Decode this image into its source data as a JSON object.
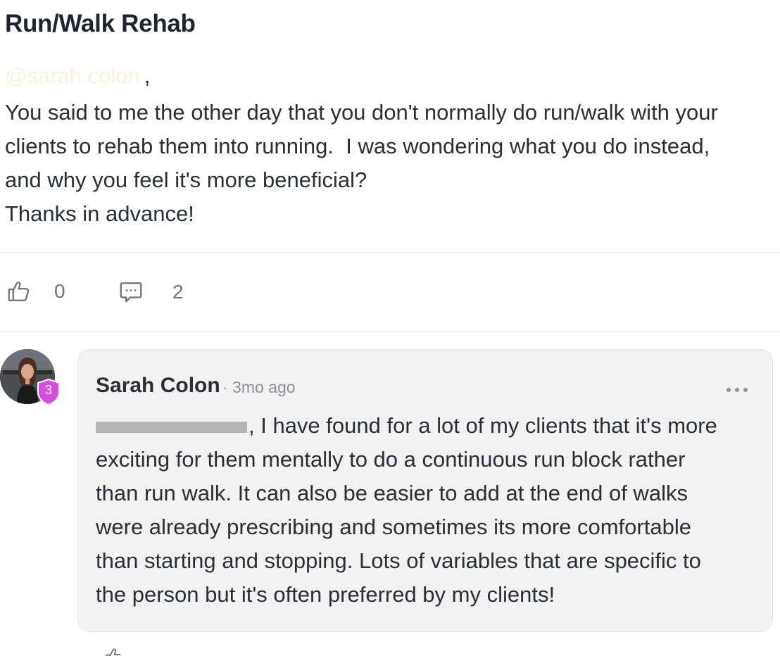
{
  "post": {
    "title": "Run/Walk Rehab",
    "mention": "@sarah colon",
    "mention_suffix": ",",
    "body_lines": [
      "You said to me the other day that you don't normally do run/walk with your",
      "clients to rehab them into running.  I was wondering what you do instead,",
      "and why you feel it's more beneficial?",
      "Thanks in advance!"
    ],
    "likes": "0",
    "comments": "2"
  },
  "comment": {
    "author": "Sarah Colon",
    "meta": "· 3mo ago",
    "level": "3",
    "body_after_redaction": ", I have found for a lot of my clients that it's more",
    "body_lines": [
      "exciting for them mentally to do a continuous run block rather",
      "than run walk. It can also be easier to add at the end of walks",
      "were already prescribing and sometimes its more comfortable",
      "than starting and stopping. Lots of variables that are specific to",
      "the person but it's often preferred by my clients!"
    ]
  },
  "colors": {
    "text": "#2a2f37",
    "muted": "#6b7280",
    "card_bg": "#f2f2f3",
    "badge": "#d64be0"
  },
  "icons": {
    "like": "thumbs-up-icon",
    "comment": "speech-bubble-icon",
    "more": "more-horizontal-icon",
    "badge": "shield-icon"
  }
}
